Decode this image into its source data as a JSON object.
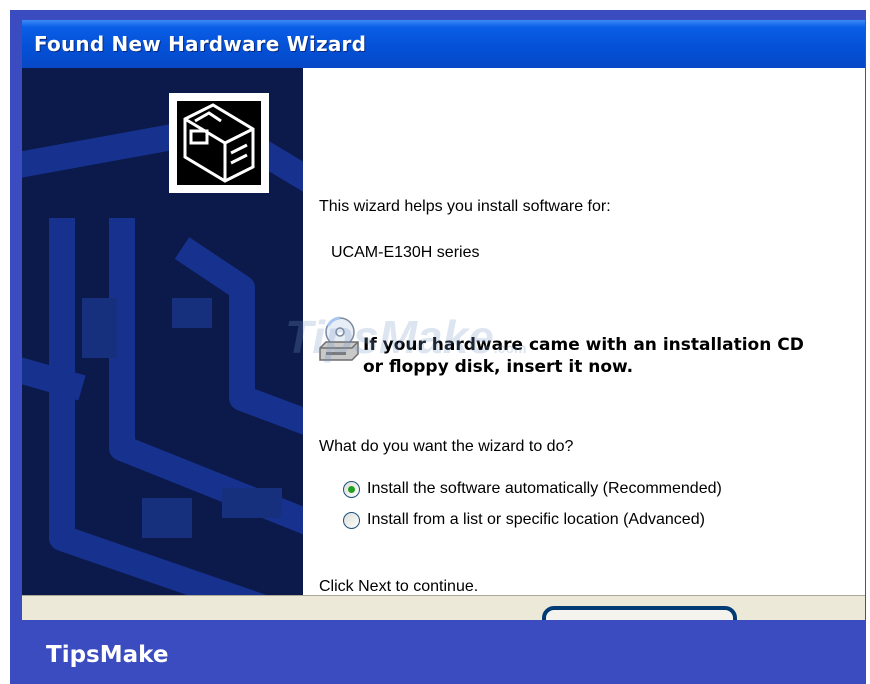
{
  "window": {
    "title": "Found New Hardware Wizard"
  },
  "wizard": {
    "intro": "This wizard helps you install software for:",
    "device_name": "UCAM-E130H series",
    "cd_prompt_line1": "If your hardware came with an installation CD",
    "cd_prompt_line2": "or floppy disk, insert it now.",
    "question": "What do you want the wizard to do?",
    "options": [
      {
        "label": "Install the software automatically (Recommended)",
        "selected": true
      },
      {
        "label": "Install from a list or specific location (Advanced)",
        "selected": false
      }
    ],
    "footer": "Click Next to continue."
  },
  "watermark": {
    "text": "TipsMake",
    "suffix": ".com"
  },
  "banner": {
    "brand": "TipsMake"
  },
  "icons": [
    "hardware-icon",
    "cd-drive-icon",
    "radio-button"
  ],
  "colors": {
    "frame": "#3a4cbf",
    "titlebar": "#0450d6",
    "left_panel": "#0b1a4a",
    "radio_dot": "#21a121"
  }
}
